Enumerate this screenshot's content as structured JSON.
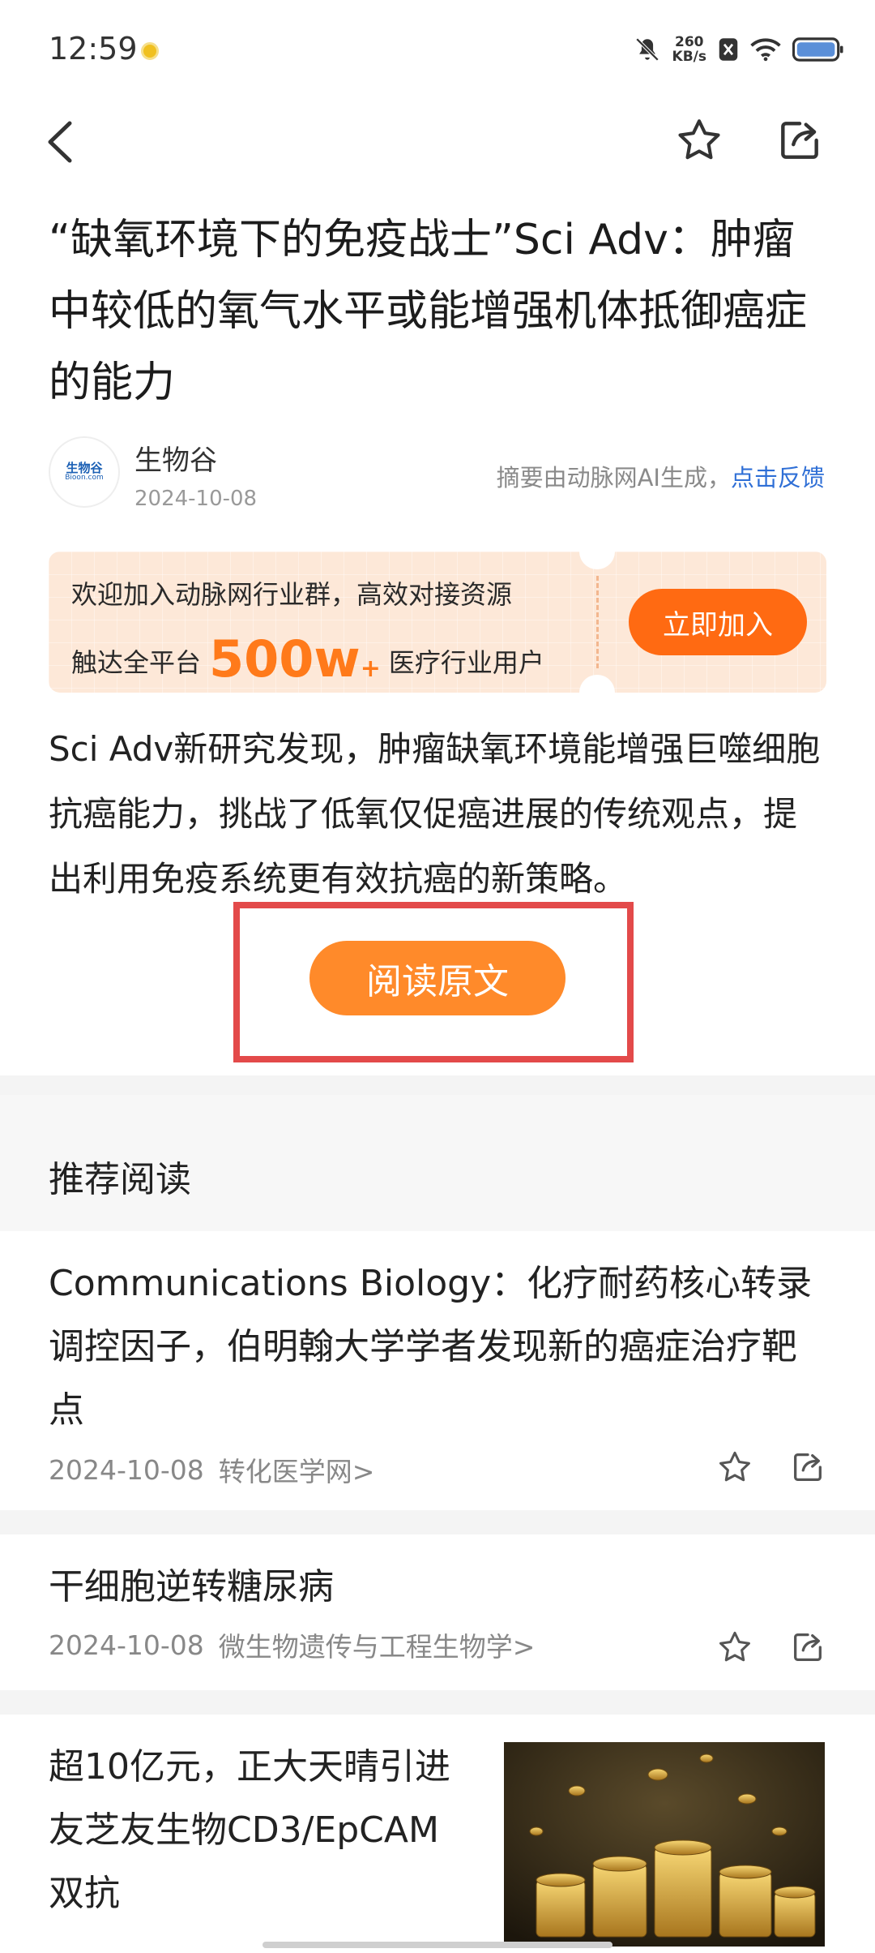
{
  "status_bar": {
    "time": "12:59",
    "net_speed_top": "260",
    "net_speed_bottom": "KB/s"
  },
  "article": {
    "title": "“缺氧环境下的免疫战士”Sci Adv：肿瘤中较低的氧气水平或能增强机体抵御癌症的能力",
    "source_name": "生物谷",
    "source_logo_text": "生物谷",
    "source_logo_sub": "Bioon.com",
    "date": "2024-10-08",
    "ai_note": "摘要由动脉网AI生成，",
    "ai_feedback_link": "点击反馈",
    "summary": "Sci Adv新研究发现，肿瘤缺氧环境能增强巨噬细胞抗癌能力，挑战了低氧仅促癌进展的传统观点，提出利用免疫系统更有效抗癌的新策略。",
    "read_button": "阅读原文"
  },
  "banner": {
    "line1": "欢迎加入动脉网行业群，高效对接资源",
    "line2_prefix": "触达全平台",
    "highlight_number": "500w",
    "highlight_plus": "+",
    "line2_suffix": "医疗行业用户",
    "join_button": "立即加入",
    "accent_color": "#ff6a12"
  },
  "recommend": {
    "header": "推荐阅读",
    "items": [
      {
        "title": "Communications Biology：化疗耐药核心转录调控因子，伯明翰大学学者发现新的癌症治疗靶点",
        "date": "2024-10-08",
        "source": "转化医学网>"
      },
      {
        "title": "干细胞逆转糖尿病",
        "date": "2024-10-08",
        "source": "微生物遗传与工程生物学>"
      },
      {
        "title": "超10亿元，正大天晴引进友芝友生物CD3/EpCAM双抗"
      }
    ]
  },
  "icons": [
    "back-icon",
    "star-icon",
    "share-icon",
    "mute-icon",
    "wifi-icon",
    "battery-icon",
    "sim-icon"
  ]
}
